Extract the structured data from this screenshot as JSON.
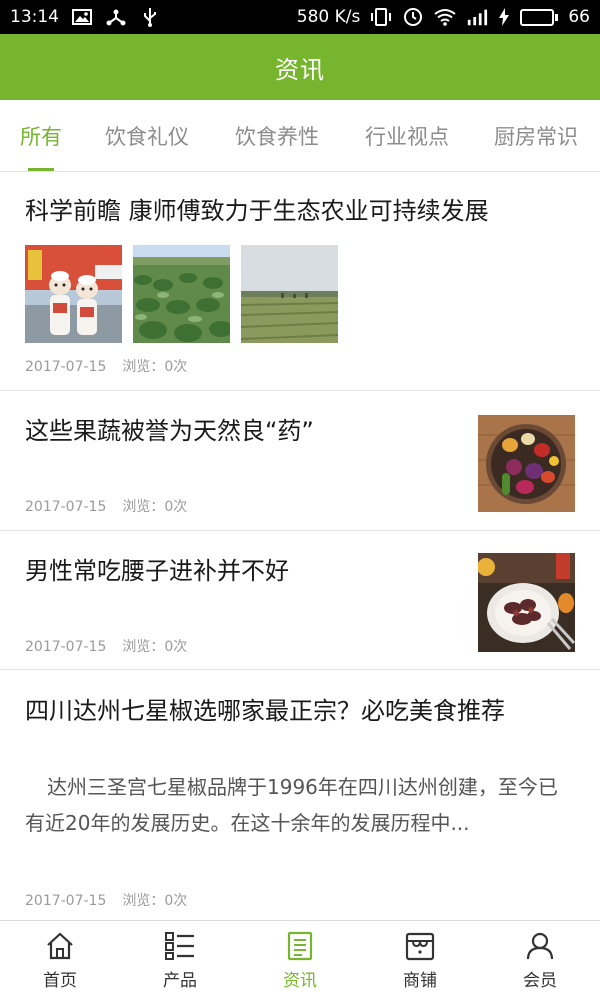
{
  "status_bar": {
    "time": "13:14",
    "net_speed": "580 K/s",
    "battery": "66",
    "battery_level": 0.66,
    "icons": [
      "gallery-icon",
      "usb-share-icon",
      "usb-icon",
      "vibrate-icon",
      "alarm-icon",
      "wifi-icon",
      "signal-icon",
      "charging-icon",
      "battery-icon"
    ]
  },
  "header": {
    "title": "资讯"
  },
  "tabs": [
    {
      "label": "所有",
      "active": true
    },
    {
      "label": "饮食礼仪"
    },
    {
      "label": "饮食养性"
    },
    {
      "label": "行业视点"
    },
    {
      "label": "厨房常识"
    }
  ],
  "news": [
    {
      "title": "科学前瞻 康师傅致力于生态农业可持续发展",
      "date": "2017-07-15",
      "views": "浏览：0次",
      "images": [
        "mascot-photo",
        "vegetable-field-photo",
        "farmland-photo"
      ]
    },
    {
      "title": "这些果蔬被誉为天然良“药”",
      "date": "2017-07-15",
      "views": "浏览：0次",
      "image": "vegetable-bowl-photo"
    },
    {
      "title": "男性常吃腰子进补并不好",
      "date": "2017-07-15",
      "views": "浏览：0次",
      "image": "kidney-dish-photo"
    },
    {
      "title": "四川达州七星椒选哪家最正宗？必吃美食推荐",
      "excerpt": "达州三圣宫七星椒品牌于1996年在四川达州创建，至今已有近20年的发展历史。在这十余年的发展历程中...",
      "date": "2017-07-15",
      "views": "浏览：0次"
    }
  ],
  "bottom_nav": [
    {
      "label": "首页",
      "icon": "home-icon"
    },
    {
      "label": "产品",
      "icon": "product-list-icon"
    },
    {
      "label": "资讯",
      "icon": "news-icon",
      "active": true
    },
    {
      "label": "商铺",
      "icon": "shop-icon"
    },
    {
      "label": "会员",
      "icon": "member-icon"
    }
  ],
  "colors": {
    "accent": "#76b52d",
    "text": "#1a1a1a",
    "muted": "#9b9b9b",
    "divider": "#e2e2e2"
  }
}
